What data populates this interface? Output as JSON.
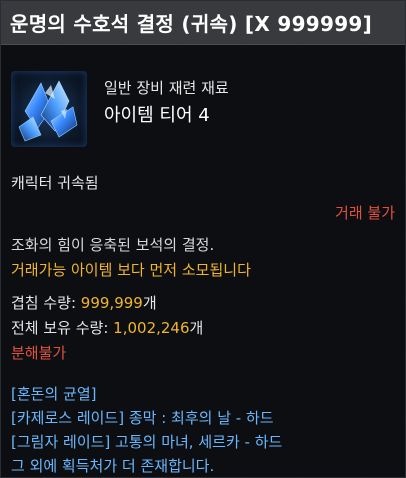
{
  "tooltip": {
    "title": "운명의 수호석 결정 (귀속) [X 999999]",
    "icon": "blue-crystal-icon",
    "sub_type": "일반 장비 재련 재료",
    "tier": "아이템 티어 4",
    "bound_status": "캐릭터 귀속됨",
    "trade_status": "거래 불가",
    "description_1": "조화의 힘이 응축된 보석의 결정.",
    "description_2": "거래가능 아이템 보다 먼저 소모됩니다",
    "stack_label": "겹침 수량: ",
    "stack_value": "999,999",
    "stack_unit": "개",
    "owned_label": "전체 보유 수량: ",
    "owned_value": "1,002,246",
    "owned_unit": "개",
    "dismantle": "분해불가",
    "sources": [
      "[혼돈의 균열]",
      "[카제로스 레이드] 종막 : 최후의 날 - 하드",
      "[그림자 레이드] 고통의 마녀, 세르카 - 하드",
      "그 외에 획득처가 더 존재합니다."
    ]
  },
  "colors": {
    "title_bar": "#383a3e",
    "gold": "#f0b52c",
    "red": "#e0513f",
    "blue": "#69b8ff"
  }
}
